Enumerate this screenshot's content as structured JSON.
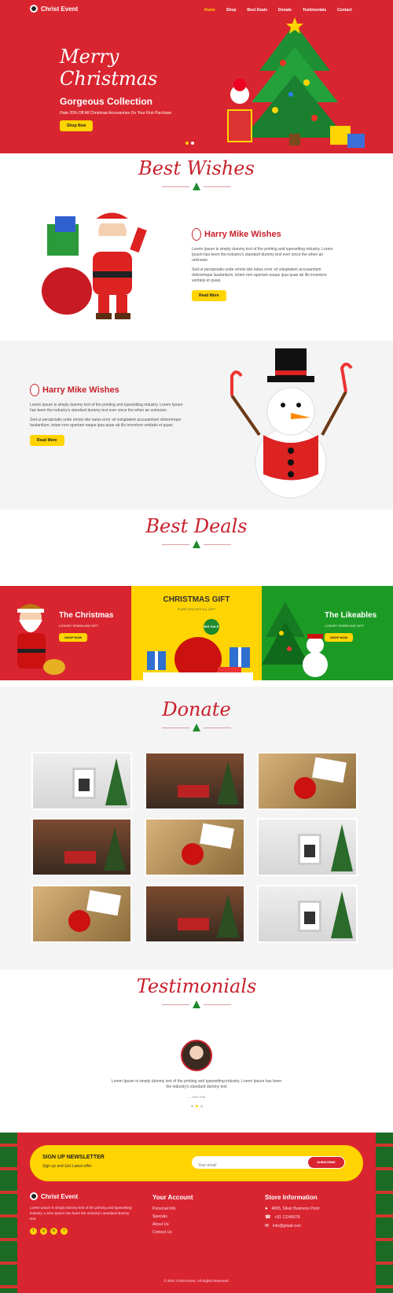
{
  "brand": {
    "name": "Christ Event"
  },
  "nav": {
    "items": [
      "Home",
      "Shop",
      "Best Deals",
      "Donate",
      "Testimonials",
      "Contact"
    ],
    "active_index": 0
  },
  "hero": {
    "title_line1": "Merry",
    "title_line2": "Christmas",
    "subtitle": "Gorgeous Collection",
    "tagline": "Flate 20% Off All Christmas Accessories On Your First Purchase",
    "button": "Shop Now"
  },
  "best_wishes": {
    "heading": "Best Wishes",
    "block1": {
      "title": "Harry Mike Wishes",
      "para1": "Lorem Ipsum is simply dummy text of the printing and typesetting industry. Lorem Ipsum has been the industry's standard dummy text ever since the when an unknown.",
      "para2": "Sed ut perspiciatis unde omnis iste natus error sit voluptatem accusantium doloremque laudantium, totam rem aperiam eaque ipsa quae ab illo inventore veritatis et quasi.",
      "button": "Read More"
    },
    "block2": {
      "title": "Harry Mike Wishes",
      "para1": "Lorem Ipsum is simply dummy text of the printing and typesetting industry. Lorem Ipsum has been the industry's standard dummy text ever since the when an unknown.",
      "para2": "Sed ut perspiciatis unde omnis iste natus error sit voluptatem accusantium doloremque laudantium, totam rem aperiam eaque ipsa quae ab illo inventore veritatis et quasi.",
      "button": "Read More"
    }
  },
  "best_deals": {
    "heading": "Best Deals",
    "cards": [
      {
        "title": "The Christmas",
        "sub": "LOXURY SPARKLING GIFT",
        "button": "SHOP NOW"
      },
      {
        "title": "CHRISTMAS GIFT",
        "sub": "FLATE 20% OFF ALL GIFT",
        "badge": "BIG SALE"
      },
      {
        "title": "The Likeables",
        "sub": "LOXURY SPARKLING GIFT",
        "button": "SHOP NOW"
      }
    ]
  },
  "donate": {
    "heading": "Donate"
  },
  "testimonials": {
    "heading": "Testimonials",
    "quote": "Lorem Ipsum is simply dummy text of the printing and typesetting industry. Lorem Ipsum has been the industry's standard dummy text",
    "author": "— John Doe"
  },
  "newsletter": {
    "title": "SIGN UP NEWSLETTER",
    "subtitle": "Sign up and Get Latest offer",
    "placeholder": "Your email",
    "button": "SUBSCRIBE"
  },
  "footer": {
    "about": "Lorem Ipsum is simply dummy text of the printing and typesetting industry. Lorem Ipsum has been the industry's standard dummy text.",
    "account_title": "Your Account",
    "account_links": [
      "Personal Info",
      "Specials",
      "About Us",
      "Contact Us"
    ],
    "store_title": "Store Information",
    "store_lines": [
      "4005, Silver Business Point",
      "+91 12345678",
      "info@gmail.com"
    ],
    "copyright": "© 2021 Christ Event. All Rights Reserved."
  },
  "colors": {
    "primary": "#d92530",
    "accent": "#ffd400",
    "green": "#1e8a2e"
  }
}
